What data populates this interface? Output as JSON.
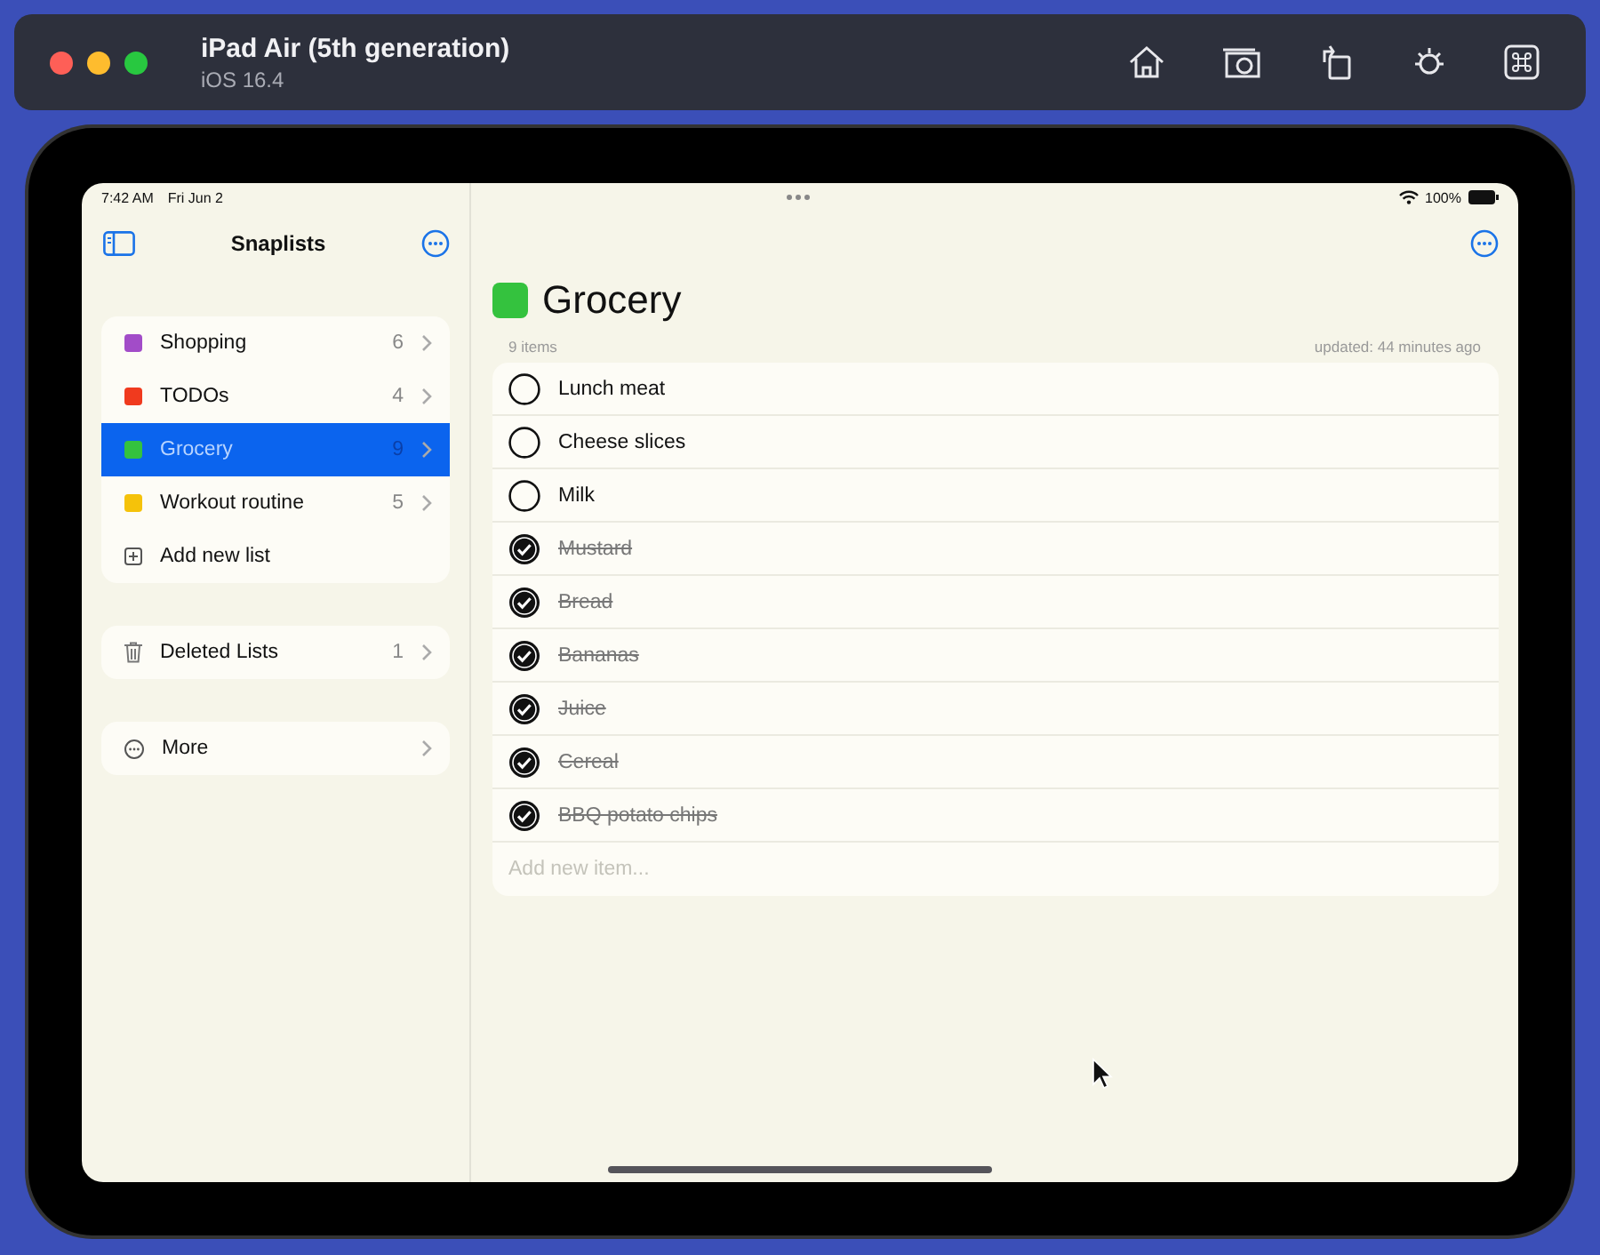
{
  "window": {
    "title": "iPad Air (5th generation)",
    "subtitle": "iOS 16.4"
  },
  "status_bar": {
    "time": "7:42 AM",
    "date": "Fri Jun 2",
    "battery": "100%"
  },
  "sidebar": {
    "title": "Snaplists",
    "lists": [
      {
        "name": "Shopping",
        "count": "6",
        "color": "#a24cc8",
        "selected": false
      },
      {
        "name": "TODOs",
        "count": "4",
        "color": "#f03a1e",
        "selected": false
      },
      {
        "name": "Grocery",
        "count": "9",
        "color": "#34c23e",
        "selected": true
      },
      {
        "name": "Workout routine",
        "count": "5",
        "color": "#f5c20a",
        "selected": false
      }
    ],
    "add_label": "Add new list",
    "deleted": {
      "label": "Deleted Lists",
      "count": "1"
    },
    "more": {
      "label": "More"
    }
  },
  "detail": {
    "title": "Grocery",
    "color": "#34c23e",
    "item_count": "9 items",
    "updated": "updated: 44 minutes ago",
    "items": [
      {
        "text": "Lunch meat",
        "checked": false
      },
      {
        "text": "Cheese slices",
        "checked": false
      },
      {
        "text": "Milk",
        "checked": false
      },
      {
        "text": "Mustard",
        "checked": true
      },
      {
        "text": "Bread",
        "checked": true
      },
      {
        "text": "Bananas",
        "checked": true
      },
      {
        "text": "Juice",
        "checked": true
      },
      {
        "text": "Cereal",
        "checked": true
      },
      {
        "text": "BBQ potato chips",
        "checked": true
      }
    ],
    "add_placeholder": "Add new item..."
  }
}
